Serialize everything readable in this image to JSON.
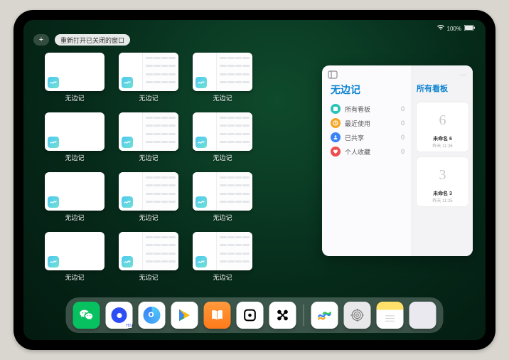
{
  "status": {
    "battery_text": "100%"
  },
  "top": {
    "plus_label": "+",
    "reopen_label": "重新打开已关闭的窗口"
  },
  "app_card_label": "无边记",
  "cards": [
    {
      "kind": "white"
    },
    {
      "kind": "split"
    },
    {
      "kind": "split"
    },
    {
      "kind": "white"
    },
    {
      "kind": "split"
    },
    {
      "kind": "split"
    },
    {
      "kind": "white"
    },
    {
      "kind": "split"
    },
    {
      "kind": "split"
    },
    {
      "kind": "white"
    },
    {
      "kind": "split"
    },
    {
      "kind": "split"
    }
  ],
  "panel": {
    "title": "无边记",
    "right_title": "所有看板",
    "more": "…",
    "menu": [
      {
        "icon": "teal",
        "label": "所有看板",
        "count": "0"
      },
      {
        "icon": "orange",
        "label": "最近使用",
        "count": "0"
      },
      {
        "icon": "blue",
        "label": "已共享",
        "count": "0"
      },
      {
        "icon": "red",
        "label": "个人收藏",
        "count": "0"
      }
    ],
    "boards": [
      {
        "glyph": "6",
        "name": "未命名 6",
        "time": "昨天 11:26"
      },
      {
        "glyph": "3",
        "name": "未命名 3",
        "time": "昨天 11:25"
      }
    ]
  },
  "dock": {
    "items": [
      "wechat",
      "quark",
      "browser",
      "play",
      "books",
      "dot",
      "x"
    ],
    "recent": [
      "freeform",
      "settings",
      "notes",
      "library"
    ]
  }
}
